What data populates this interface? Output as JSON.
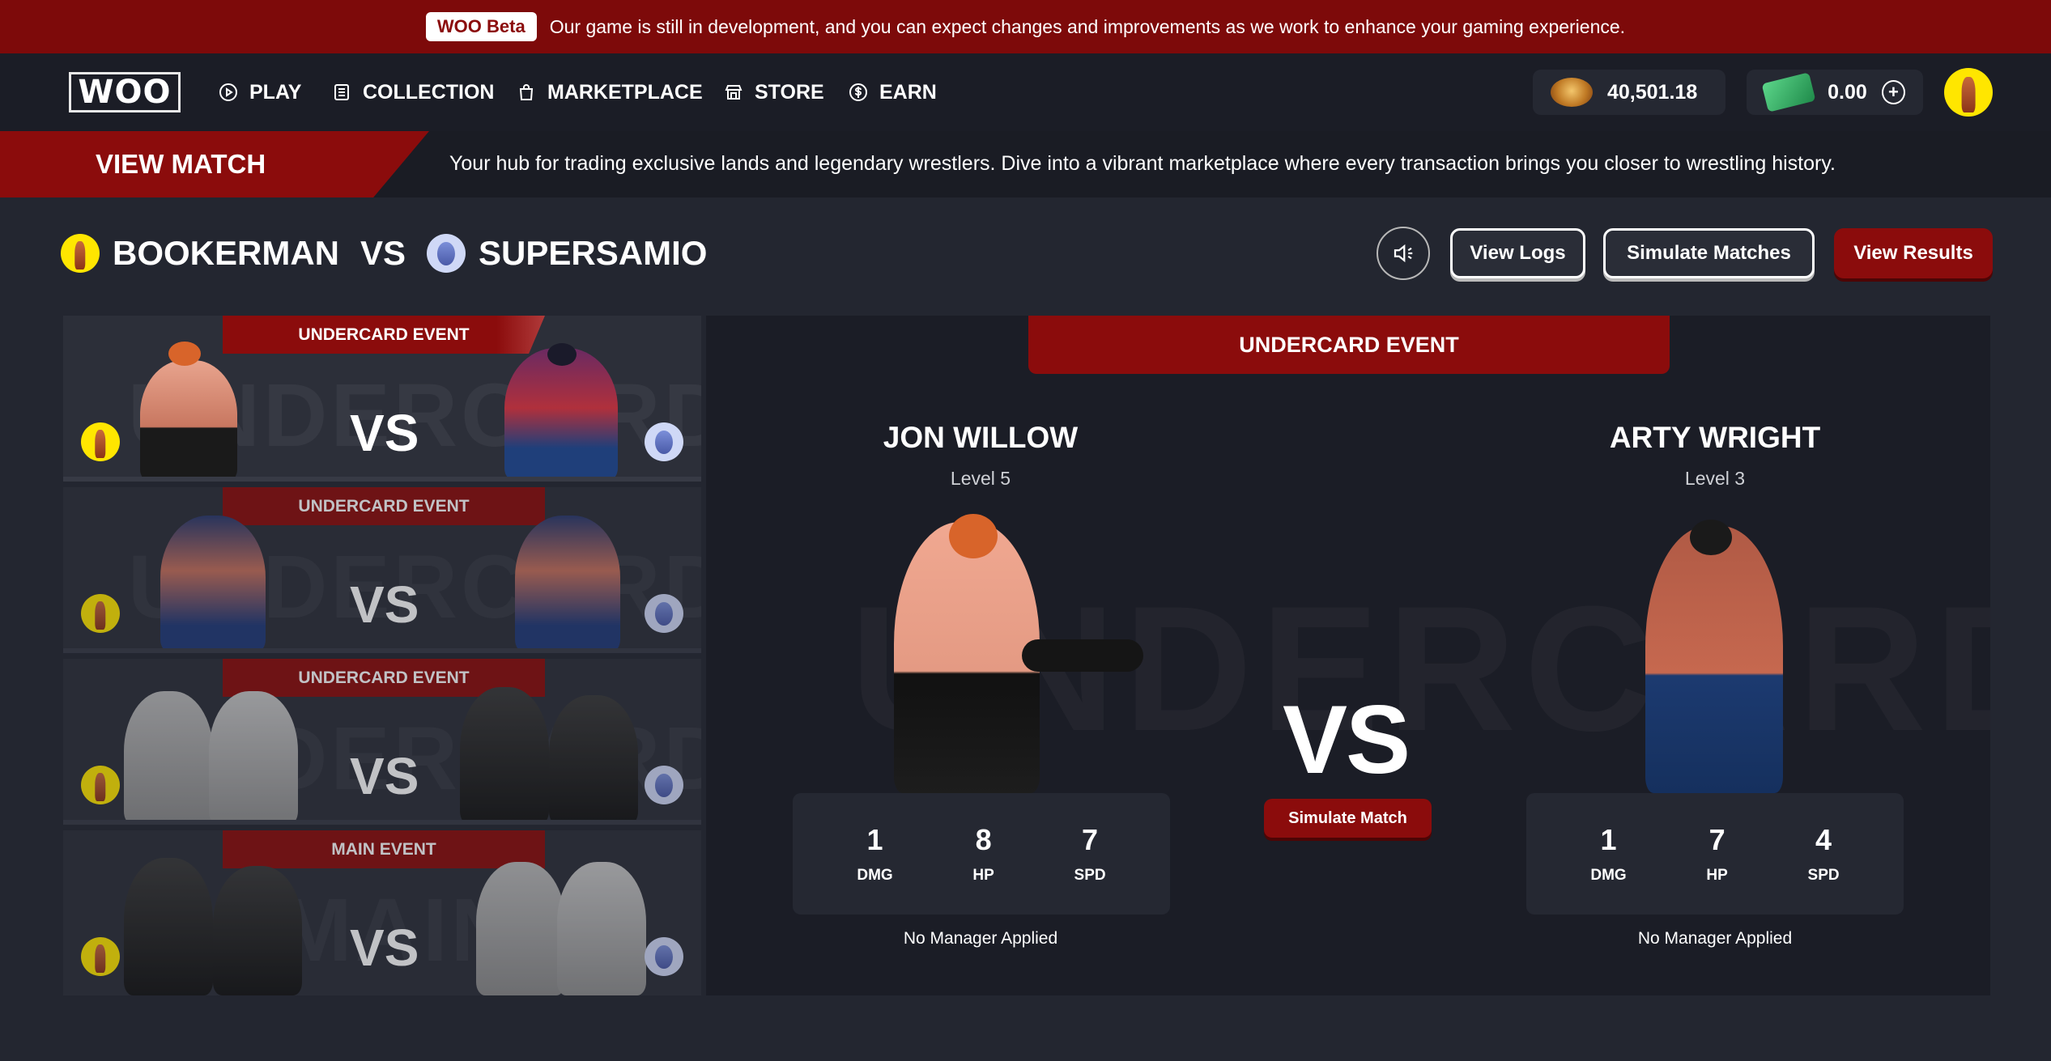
{
  "banner": {
    "badge": "WOO Beta",
    "message": "Our game is still in development, and you can expect changes and improvements as we work to enhance your gaming experience."
  },
  "nav": {
    "logo": "WOO",
    "items": [
      {
        "label": "PLAY",
        "icon": "play-circle-icon"
      },
      {
        "label": "COLLECTION",
        "icon": "list-icon"
      },
      {
        "label": "MARKETPLACE",
        "icon": "shopping-bag-icon"
      },
      {
        "label": "STORE",
        "icon": "store-icon"
      },
      {
        "label": "EARN",
        "icon": "dollar-circle-icon"
      }
    ],
    "belt_balance": "40,501.18",
    "cash_balance": "0.00"
  },
  "page": {
    "title": "VIEW MATCH",
    "description": "Your hub for trading exclusive lands and legendary wrestlers. Dive into a vibrant marketplace where every transaction brings you closer to wrestling history."
  },
  "matchup": {
    "player1": "BOOKERMAN",
    "vs": "VS",
    "player2": "SUPERSAMIO"
  },
  "controls": {
    "view_logs": "View Logs",
    "simulate_matches": "Simulate Matches",
    "view_results": "View Results"
  },
  "matches": [
    {
      "event": "UNDERCARD EVENT",
      "bg": "UNDERCARD",
      "vs": "VS"
    },
    {
      "event": "UNDERCARD EVENT",
      "bg": "UNDERCARD",
      "vs": "VS"
    },
    {
      "event": "UNDERCARD EVENT",
      "bg": "UNDERCARD",
      "vs": "VS"
    },
    {
      "event": "MAIN EVENT",
      "bg": "MAIN",
      "vs": "VS"
    }
  ],
  "detail": {
    "event": "UNDERCARD EVENT",
    "bg": "UNDERCARD",
    "vs": "VS",
    "simulate": "Simulate Match",
    "left": {
      "name": "JON WILLOW",
      "level": "Level 5",
      "stats": [
        {
          "value": "1",
          "label": "DMG"
        },
        {
          "value": "8",
          "label": "HP"
        },
        {
          "value": "7",
          "label": "SPD"
        }
      ],
      "manager": "No Manager Applied"
    },
    "right": {
      "name": "ARTY WRIGHT",
      "level": "Level 3",
      "stats": [
        {
          "value": "1",
          "label": "DMG"
        },
        {
          "value": "7",
          "label": "HP"
        },
        {
          "value": "4",
          "label": "SPD"
        }
      ],
      "manager": "No Manager Applied"
    }
  },
  "colors": {
    "brand_red": "#8b0c0c",
    "banner_red": "#7d0a0a",
    "background": "#232630",
    "panel": "#1b1d26",
    "avatar_yellow": "#ffe600"
  }
}
